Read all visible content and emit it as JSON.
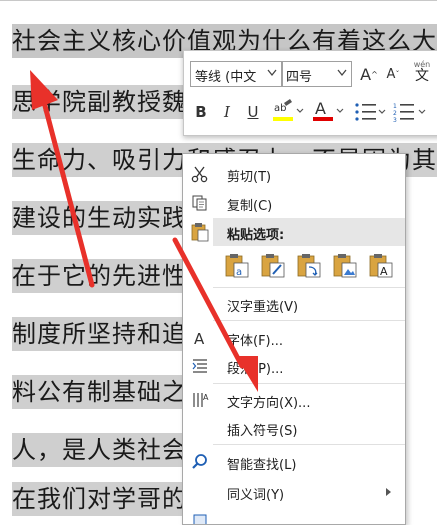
{
  "document": {
    "lines": [
      "社会主义核心价值观为什么有着这么大的",
      "思学院副教授魏",
      "生命力、吸引力和感召力，不是因为其",
      "建设的生动实践，社",
      "在于它的先进性",
      "制度所坚持和追",
      "料公有制基础之",
      "人，是人类社会",
      "在我们对学哥的"
    ]
  },
  "mini_toolbar": {
    "font_name": "等线 (中文",
    "font_size": "四号",
    "grow_glyph": "A",
    "shrink_glyph": "A",
    "phonetic_top": "wén",
    "phonetic_bottom": "文",
    "bold": "B",
    "italic": "I",
    "underline": "U",
    "font_color_glyph": "A",
    "highlight_color": "#ffff00",
    "font_color": "#e00000"
  },
  "context_menu": {
    "items": [
      {
        "label": "剪切(T)",
        "icon": "scissors-icon"
      },
      {
        "label": "复制(C)",
        "icon": "copy-icon"
      },
      {
        "label": "粘贴选项:",
        "icon": "clipboard-icon"
      },
      {
        "label": "汉字重选(V)",
        "icon": ""
      },
      {
        "label": "字体(F)...",
        "icon": "font-icon"
      },
      {
        "label": "段落(P)...",
        "icon": "paragraph-icon"
      },
      {
        "label": "文字方向(X)...",
        "icon": "text-direction-icon"
      },
      {
        "label": "插入符号(S)",
        "icon": ""
      },
      {
        "label": "智能查找(L)",
        "icon": "smart-lookup-icon"
      },
      {
        "label": "同义词(Y)",
        "icon": ""
      }
    ],
    "paste_options": [
      "keep-source-formatting-icon",
      "merge-formatting-icon",
      "picture-icon",
      "keep-text-only-icon",
      "paste-picture-icon",
      "paste-text-icon"
    ]
  },
  "annotation_color": "#e8312a"
}
